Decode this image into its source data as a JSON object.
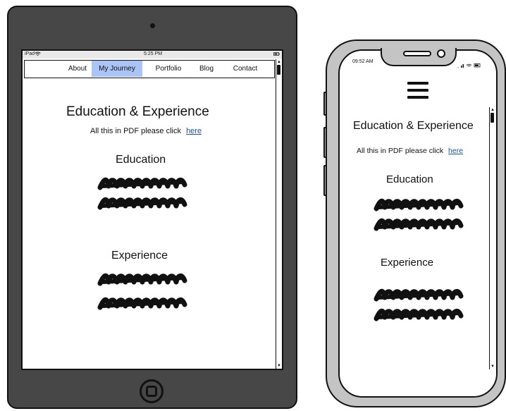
{
  "tablet": {
    "status": {
      "device": "iPad",
      "time": "5:25 PM"
    },
    "nav": [
      {
        "label": "About",
        "active": false
      },
      {
        "label": "My Journey",
        "active": true
      },
      {
        "label": "Portfolio",
        "active": false
      },
      {
        "label": "Blog",
        "active": false
      },
      {
        "label": "Contact",
        "active": false
      }
    ],
    "heading": "Education & Experience",
    "pdf_text": "All this in PDF please click",
    "pdf_link": "here",
    "education_heading": "Education",
    "experience_heading": "Experience"
  },
  "phone": {
    "status": {
      "time": "09:52 AM"
    },
    "menu_icon": "hamburger-icon",
    "heading": "Education & Experience",
    "pdf_text": "All this in PDF please click",
    "pdf_link": "here",
    "education_heading": "Education",
    "experience_heading": "Experience"
  },
  "colors": {
    "device_body": "#474747",
    "phone_frame": "#c4c4c4",
    "nav_active": "#a9c4f5",
    "link": "#1a4fb5"
  }
}
